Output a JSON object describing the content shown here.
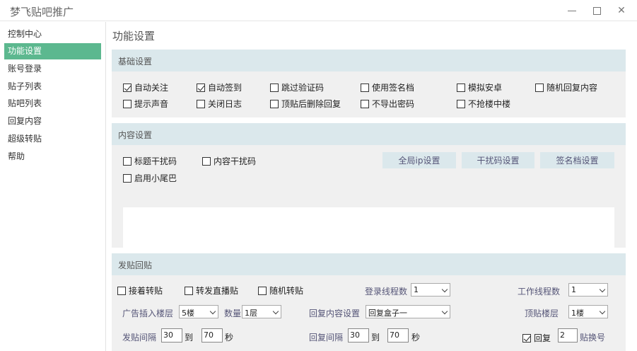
{
  "window": {
    "title": "梦飞贴吧推广"
  },
  "sidebar": {
    "items": [
      {
        "label": "控制中心"
      },
      {
        "label": "功能设置",
        "active": true
      },
      {
        "label": "账号登录"
      },
      {
        "label": "贴子列表"
      },
      {
        "label": "贴吧列表"
      },
      {
        "label": "回复内容"
      },
      {
        "label": "超级转贴"
      },
      {
        "label": "帮助"
      }
    ]
  },
  "page_title": "功能设置",
  "basic": {
    "header": "基础设置",
    "options": [
      {
        "label": "自动关注",
        "checked": true
      },
      {
        "label": "自动签到",
        "checked": true
      },
      {
        "label": "跳过验证码",
        "checked": false
      },
      {
        "label": "使用签名档",
        "checked": false
      },
      {
        "label": "模拟安卓",
        "checked": false
      },
      {
        "label": "随机回复内容",
        "checked": false
      },
      {
        "label": "提示声音",
        "checked": false
      },
      {
        "label": "关闭日志",
        "checked": false
      },
      {
        "label": "顶贴后删除回复",
        "checked": false
      },
      {
        "label": "不导出密码",
        "checked": false
      },
      {
        "label": "不抢楼中楼",
        "checked": false
      }
    ]
  },
  "content_settings": {
    "header": "内容设置",
    "options": [
      {
        "label": "标题干扰码",
        "checked": false
      },
      {
        "label": "内容干扰码",
        "checked": false
      },
      {
        "label": "启用小尾巴",
        "checked": false
      }
    ],
    "buttons": [
      "全局ip设置",
      "干扰码设置",
      "签名档设置"
    ],
    "text": ""
  },
  "posting": {
    "header": "发贴回贴",
    "options": [
      {
        "label": "接着转贴",
        "checked": false
      },
      {
        "label": "转发直播贴",
        "checked": false
      },
      {
        "label": "随机转贴",
        "checked": false
      }
    ],
    "login_threads_label": "登录线程数",
    "login_threads_value": "1",
    "work_threads_label": "工作线程数",
    "work_threads_value": "1",
    "ad_floor_label": "广告插入楼层",
    "ad_floor_value": "5楼",
    "count_label": "数量",
    "count_value": "1层",
    "reply_content_label": "回复内容设置",
    "reply_content_value": "回复盒子一",
    "top_floor_label": "顶贴楼层",
    "top_floor_value": "1楼",
    "post_interval_label": "发贴间隔",
    "post_interval_from": "30",
    "post_interval_to": "70",
    "to_label": "到",
    "seconds_label": "秒",
    "reply_interval_label": "回复间隔",
    "reply_interval_from": "30",
    "reply_interval_to": "70",
    "reply_option_label": "回复",
    "reply_option_checked": true,
    "reply_count_value": "2",
    "switch_account_label": "贴换号"
  }
}
